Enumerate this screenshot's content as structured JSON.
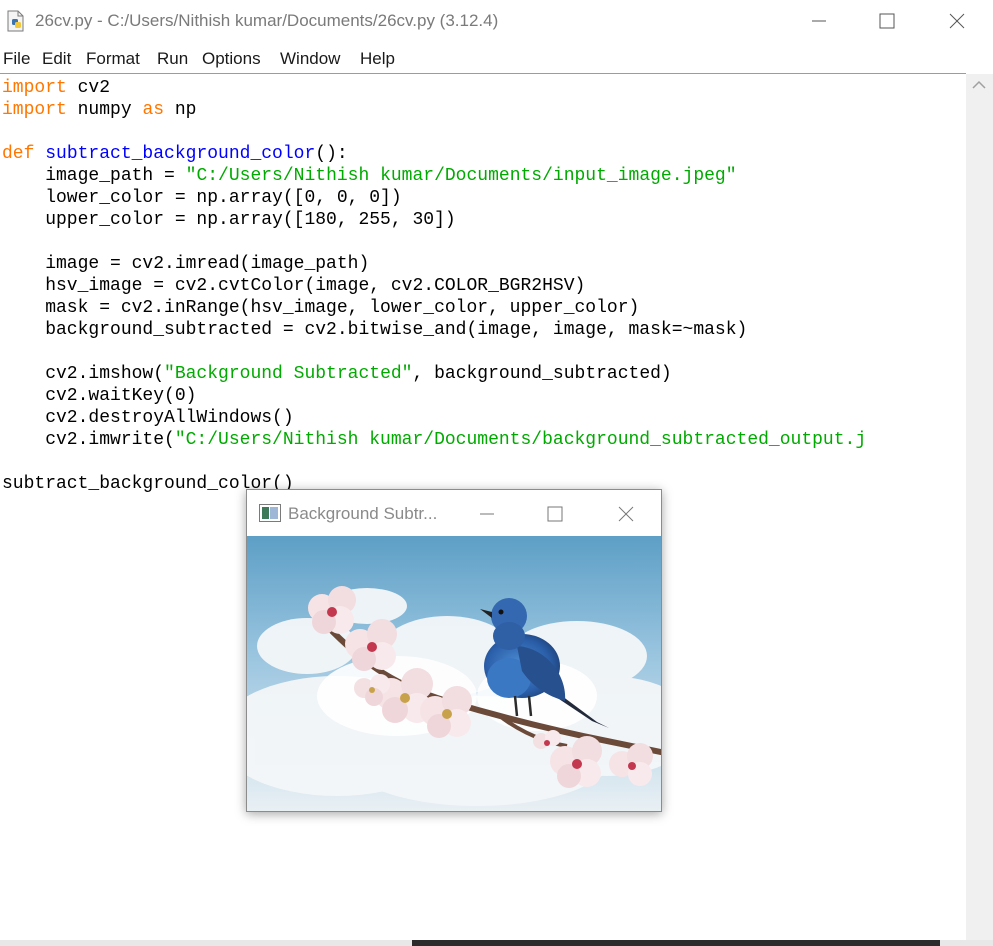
{
  "window": {
    "title": "26cv.py - C:/Users/Nithish kumar/Documents/26cv.py (3.12.4)"
  },
  "menu": [
    "File",
    "Edit",
    "Format",
    "Run",
    "Options",
    "Window",
    "Help"
  ],
  "code": {
    "line1_kw": "import",
    "line1_rest": " cv2",
    "line2_kw": "import",
    "line2_mid": " numpy ",
    "line2_kw2": "as",
    "line2_rest": " np",
    "line4_kw": "def",
    "line4_name": "subtract_background_color",
    "line4_rest": "():",
    "line5_pre": "    image_path = ",
    "line5_str": "\"C:/Users/Nithish kumar/Documents/input_image.jpeg\"",
    "line6": "    lower_color = np.array([0, 0, 0])",
    "line7": "    upper_color = np.array([180, 255, 30])",
    "line9": "    image = cv2.imread(image_path)",
    "line10": "    hsv_image = cv2.cvtColor(image, cv2.COLOR_BGR2HSV)",
    "line11": "    mask = cv2.inRange(hsv_image, lower_color, upper_color)",
    "line12": "    background_subtracted = cv2.bitwise_and(image, image, mask=~mask)",
    "line14_pre": "    cv2.imshow(",
    "line14_str": "\"Background Subtracted\"",
    "line14_rest": ", background_subtracted)",
    "line15": "    cv2.waitKey(0)",
    "line16": "    cv2.destroyAllWindows()",
    "line17_pre": "    cv2.imwrite(",
    "line17_str": "\"C:/Users/Nithish kumar/Documents/background_subtracted_output.j",
    "line19": "subtract_background_color()"
  },
  "cv_window": {
    "title": "Background Subtr..."
  },
  "colors": {
    "keyword": "#ff7700",
    "definition": "#0000ff",
    "string": "#00aa00"
  },
  "icons": [
    "python-file-icon",
    "minimize-icon",
    "maximize-icon",
    "close-icon",
    "scroll-up-icon",
    "opencv-window-icon"
  ]
}
